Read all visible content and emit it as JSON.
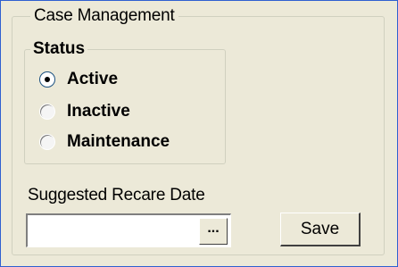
{
  "case_management": {
    "title": "Case Management",
    "status": {
      "title": "Status",
      "selected": "Active",
      "options": [
        {
          "label": "Active",
          "checked": true
        },
        {
          "label": "Inactive",
          "checked": false
        },
        {
          "label": "Maintenance",
          "checked": false
        }
      ]
    },
    "recare_date": {
      "label": "Suggested Recare Date",
      "value": "",
      "picker_label": "..."
    },
    "save_label": "Save"
  },
  "colors": {
    "window_background": "#ece9d8",
    "frame_border": "#2f5fd0",
    "group_border": "#d0d0bf"
  },
  "icons": {
    "radio_checked": "radio-checked-icon",
    "radio_unchecked": "radio-unchecked-icon"
  }
}
